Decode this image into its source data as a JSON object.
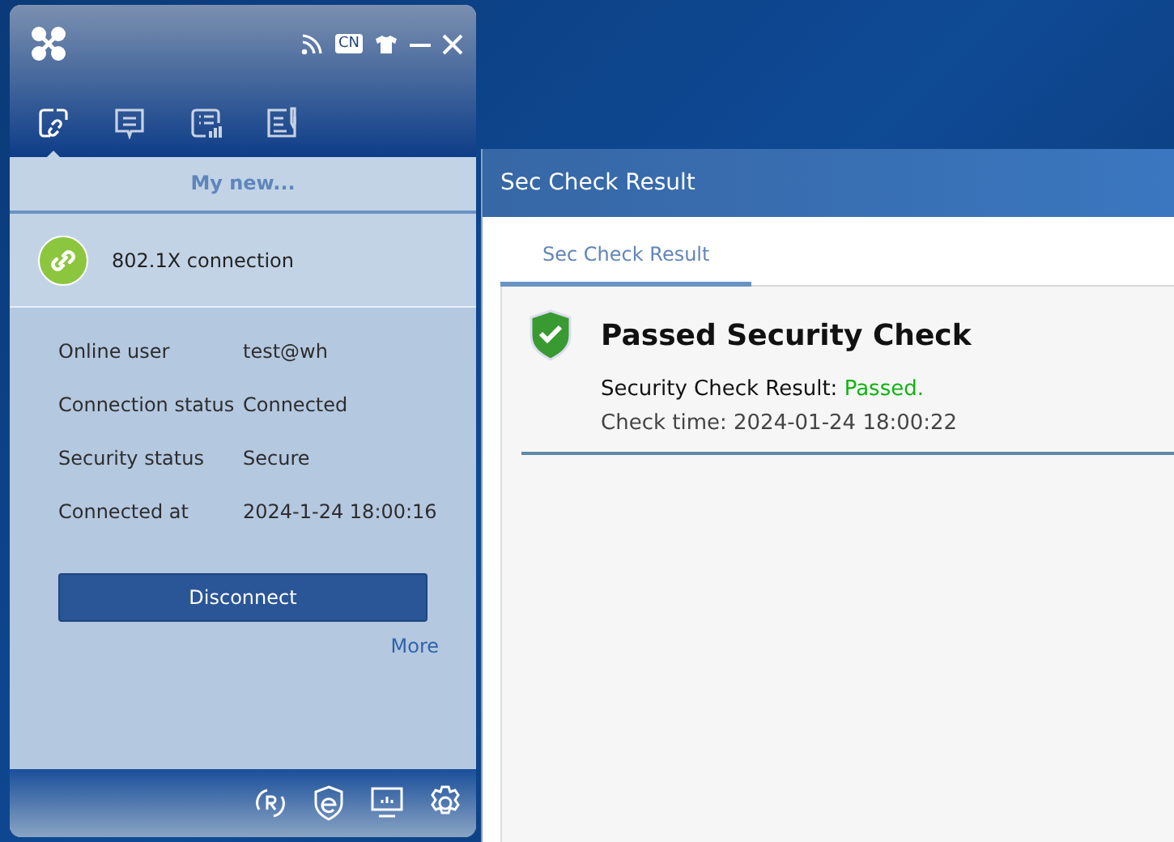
{
  "client_window": {
    "top_bar": {
      "language_badge": "CN"
    },
    "nav_tabs": [
      {
        "kind": "link",
        "selected": true
      },
      {
        "kind": "message",
        "selected": false
      },
      {
        "kind": "report",
        "selected": false
      },
      {
        "kind": "notes",
        "selected": false
      }
    ],
    "section_title": "My new...",
    "connection": {
      "name": "802.1X connection"
    },
    "details": [
      {
        "label": "Online user",
        "value": "test@wh"
      },
      {
        "label": "Connection status",
        "value": "Connected"
      },
      {
        "label": "Security status",
        "value": "Secure"
      },
      {
        "label": "Connected at",
        "value": "2024-1-24 18:00:16"
      }
    ],
    "disconnect_button": "Disconnect",
    "more_link": "More"
  },
  "result_window": {
    "title": "Sec Check Result",
    "tabs": [
      {
        "label": "Sec Check Result",
        "selected": true
      }
    ],
    "heading": "Passed Security Check",
    "result_label": "Security Check Result: ",
    "result_value": "Passed.",
    "result_passed": true,
    "check_time": "Check time: 2024-01-24 18:00:22"
  }
}
